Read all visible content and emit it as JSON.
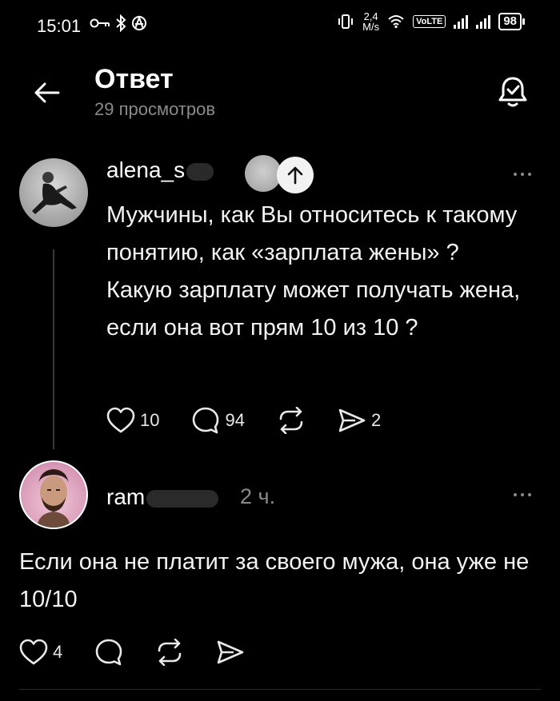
{
  "status_bar": {
    "time": "15:01",
    "speed_value": "2,4",
    "speed_unit": "M/s",
    "volte": "VoLTE",
    "battery": "98"
  },
  "header": {
    "title": "Ответ",
    "views": "29 просмотров"
  },
  "post": {
    "author": "alena_s",
    "text": "Мужчины, как Вы относитесь к такому понятию, как «зарплата жены» ? Какую зарплату может получать жена, если она вот прям 10 из 10 ?",
    "likes": "10",
    "comments": "94",
    "shares": "2"
  },
  "reply": {
    "author": "ram",
    "time": "2 ч.",
    "text": "Если она не платит за своего мужа, она уже не 10/10",
    "likes": "4"
  },
  "colors": {
    "background": "#000000",
    "text": "#f3f3f3",
    "muted": "#8a8a8a"
  },
  "icons": [
    "back-arrow-icon",
    "bell-check-icon",
    "heart-icon",
    "comment-icon",
    "repost-icon",
    "send-icon",
    "arrow-up-icon",
    "more-icon"
  ]
}
